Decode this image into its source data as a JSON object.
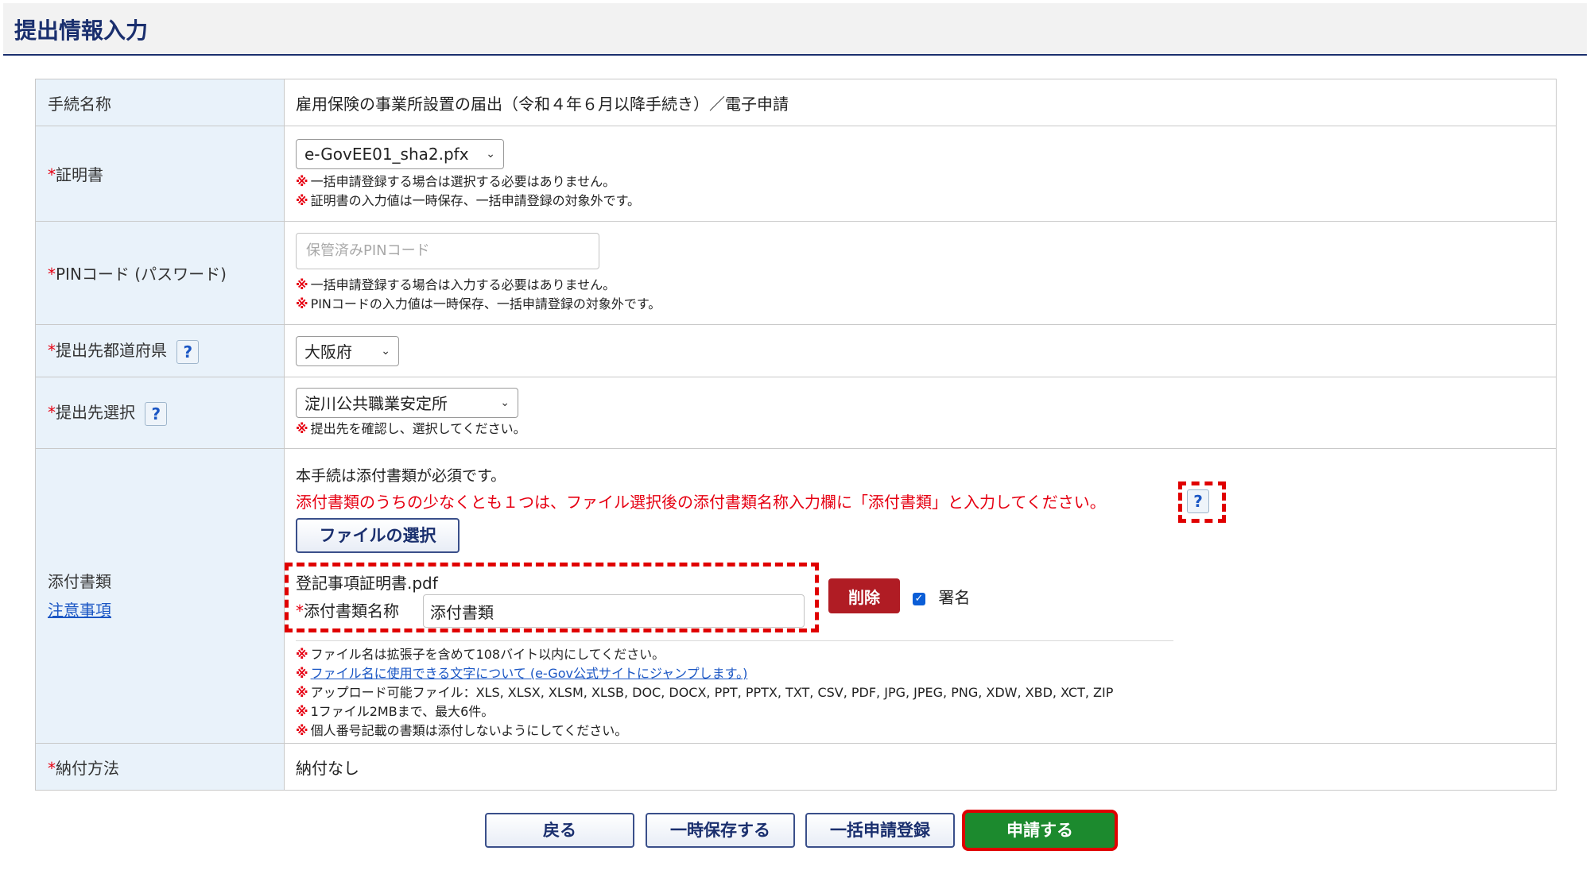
{
  "header": {
    "title": "提出情報入力"
  },
  "rows": {
    "procedure": {
      "label": "手続名称",
      "value": "雇用保険の事業所設置の届出（令和４年６月以降手続き）／電子申請"
    },
    "certificate": {
      "label": "証明書",
      "selected": "e-GovEE01_sha2.pfx",
      "notes": [
        "一括申請登録する場合は選択する必要はありません。",
        "証明書の入力値は一時保存、一括申請登録の対象外です。"
      ]
    },
    "pin": {
      "label": "PINコード (パスワード)",
      "placeholder": "保管済みPINコード",
      "notes": [
        "一括申請登録する場合は入力する必要はありません。",
        "PINコードの入力値は一時保存、一括申請登録の対象外です。"
      ]
    },
    "prefecture": {
      "label": "提出先都道府県",
      "selected": "大阪府"
    },
    "destination": {
      "label": "提出先選択",
      "selected": "淀川公共職業安定所",
      "note": "提出先を確認し、選択してください。"
    },
    "attachment": {
      "label": "添付書類",
      "link": "注意事項",
      "required_msg": "本手続は添付書類が必須です。",
      "red_msg": "添付書類のうちの少なくとも１つは、ファイル選択後の添付書類名称入力欄に「添付書類」と入力してください。",
      "file_button": "ファイルの選択",
      "file_name": "登記事項証明書.pdf",
      "name_label": "添付書類名称",
      "name_value": "添付書類",
      "delete_button": "削除",
      "sign_label": "署名",
      "notes": [
        "ファイル名は拡張子を含めて108バイト以内にしてください。",
        "ファイル名に使用できる文字について (e-Gov公式サイトにジャンプします。)",
        "アップロード可能ファイル：XLS, XLSX, XLSM, XLSB, DOC, DOCX, PPT, PPTX, TXT, CSV, PDF, JPG, JPEG, PNG, XDW, XBD, XCT, ZIP",
        "1ファイル2MBまで、最大6件。",
        "個人番号記載の書類は添付しないようにしてください。"
      ]
    },
    "payment": {
      "label": "納付方法",
      "value": "納付なし"
    }
  },
  "icons": {
    "required_mark": "*",
    "note_mark": "※",
    "help": "?",
    "checkbox_checked": "✓",
    "chevron": "⌄"
  },
  "buttons": {
    "back": "戻る",
    "save": "一時保存する",
    "batch": "一括申請登録",
    "submit": "申請する"
  },
  "colors": {
    "accent": "#1a2f6e",
    "required": "#e60012",
    "submit": "#1c8a2e",
    "delete": "#b01c24",
    "label_bg": "#e9f2fa"
  }
}
